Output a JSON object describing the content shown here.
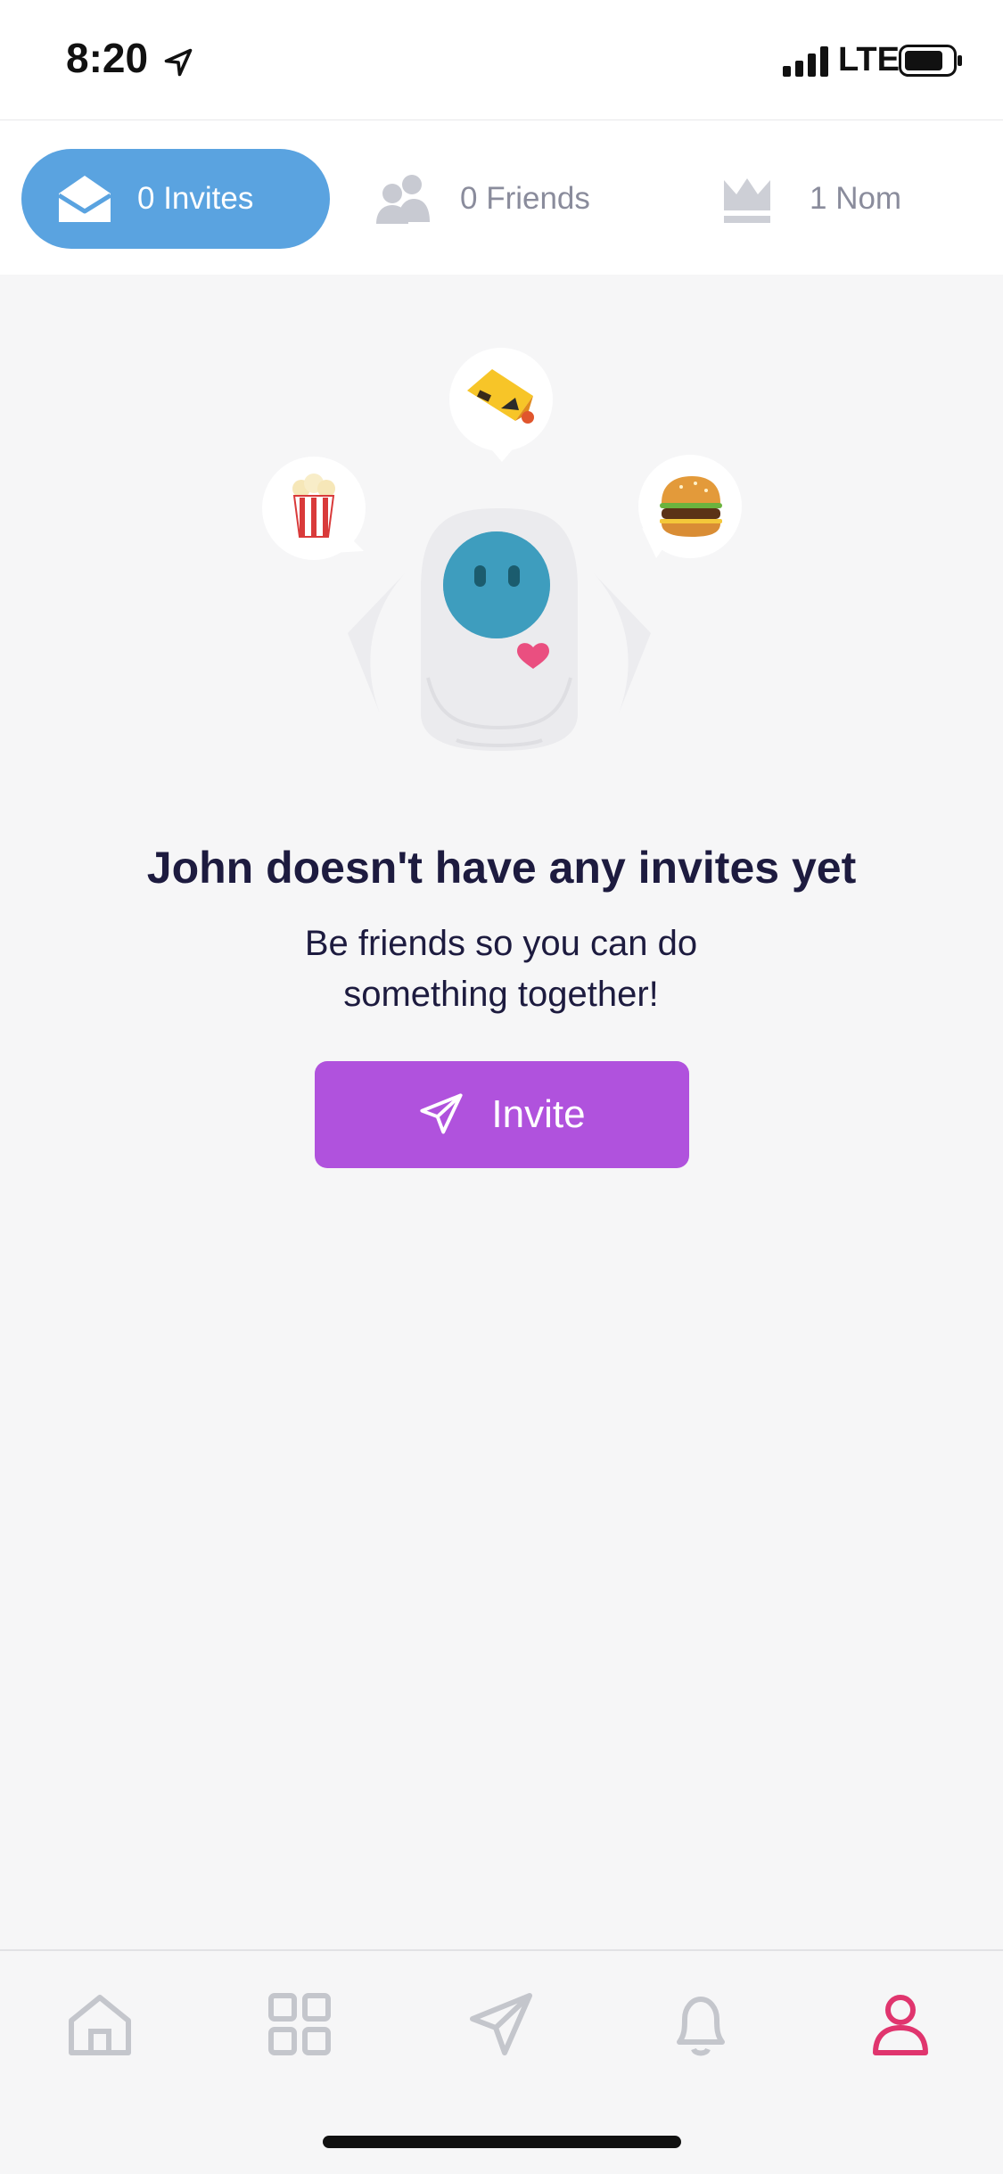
{
  "status_bar": {
    "time": "8:20",
    "network": "LTE"
  },
  "tabs": [
    {
      "label": "0 Invites",
      "icon": "envelope-open-icon",
      "active": true
    },
    {
      "label": "0 Friends",
      "icon": "users-icon",
      "active": false
    },
    {
      "label": "1 Nom",
      "icon": "crown-icon",
      "active": false
    }
  ],
  "empty_state": {
    "title": "John doesn't have any invites yet",
    "subtitle": "Be friends so you can do something together!",
    "button_label": "Invite",
    "button_icon": "paper-plane-icon"
  },
  "bottom_nav": [
    {
      "name": "home-icon",
      "active": false
    },
    {
      "name": "grid-icon",
      "active": false
    },
    {
      "name": "send-icon",
      "active": false
    },
    {
      "name": "bell-icon",
      "active": false
    },
    {
      "name": "profile-icon",
      "active": true
    }
  ],
  "colors": {
    "tab_active_bg": "#5aa3e0",
    "button_bg": "#b052dd",
    "text_dark": "#1d1b3f",
    "nav_active": "#e0356e",
    "nav_inactive": "#c4c6cc"
  }
}
